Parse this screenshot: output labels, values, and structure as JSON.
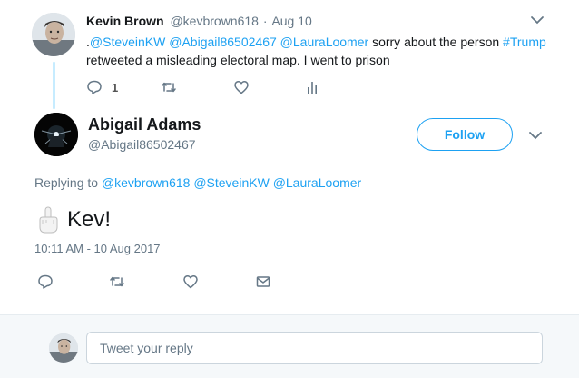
{
  "parent_tweet": {
    "author_name": "Kevin Brown",
    "author_handle": "@kevbrown618",
    "separator": "·",
    "date": "Aug 10",
    "text_prefix": ".",
    "mentions": [
      "@SteveinKW",
      "@Abigail86502467",
      "@LauraLoomer"
    ],
    "text_mid": "sorry about the person",
    "hashtag": "#Trump",
    "text_line2": "retweeted a misleading electoral map. I went to prison",
    "reply_count": "1",
    "icons": [
      "chevron-down-icon",
      "reply-icon",
      "retweet-icon",
      "heart-icon",
      "analytics-icon"
    ]
  },
  "main_tweet": {
    "author_name": "Abigail Adams",
    "author_handle": "@Abigail86502467",
    "follow_label": "Follow",
    "replying_prefix": "Replying to",
    "replying_to": [
      "@kevbrown618",
      "@SteveinKW",
      "@LauraLoomer"
    ],
    "text": "Kev!",
    "timestamp": "10:11 AM - 10 Aug 2017",
    "icons": [
      "chevron-down-icon",
      "reply-icon",
      "retweet-icon",
      "heart-icon",
      "envelope-icon"
    ]
  },
  "composer": {
    "placeholder": "Tweet your reply"
  },
  "colors": {
    "accent": "#1da1f2",
    "muted": "#657786",
    "thread_line": "#c7ecff",
    "composer_bg": "#f5f8fa"
  }
}
